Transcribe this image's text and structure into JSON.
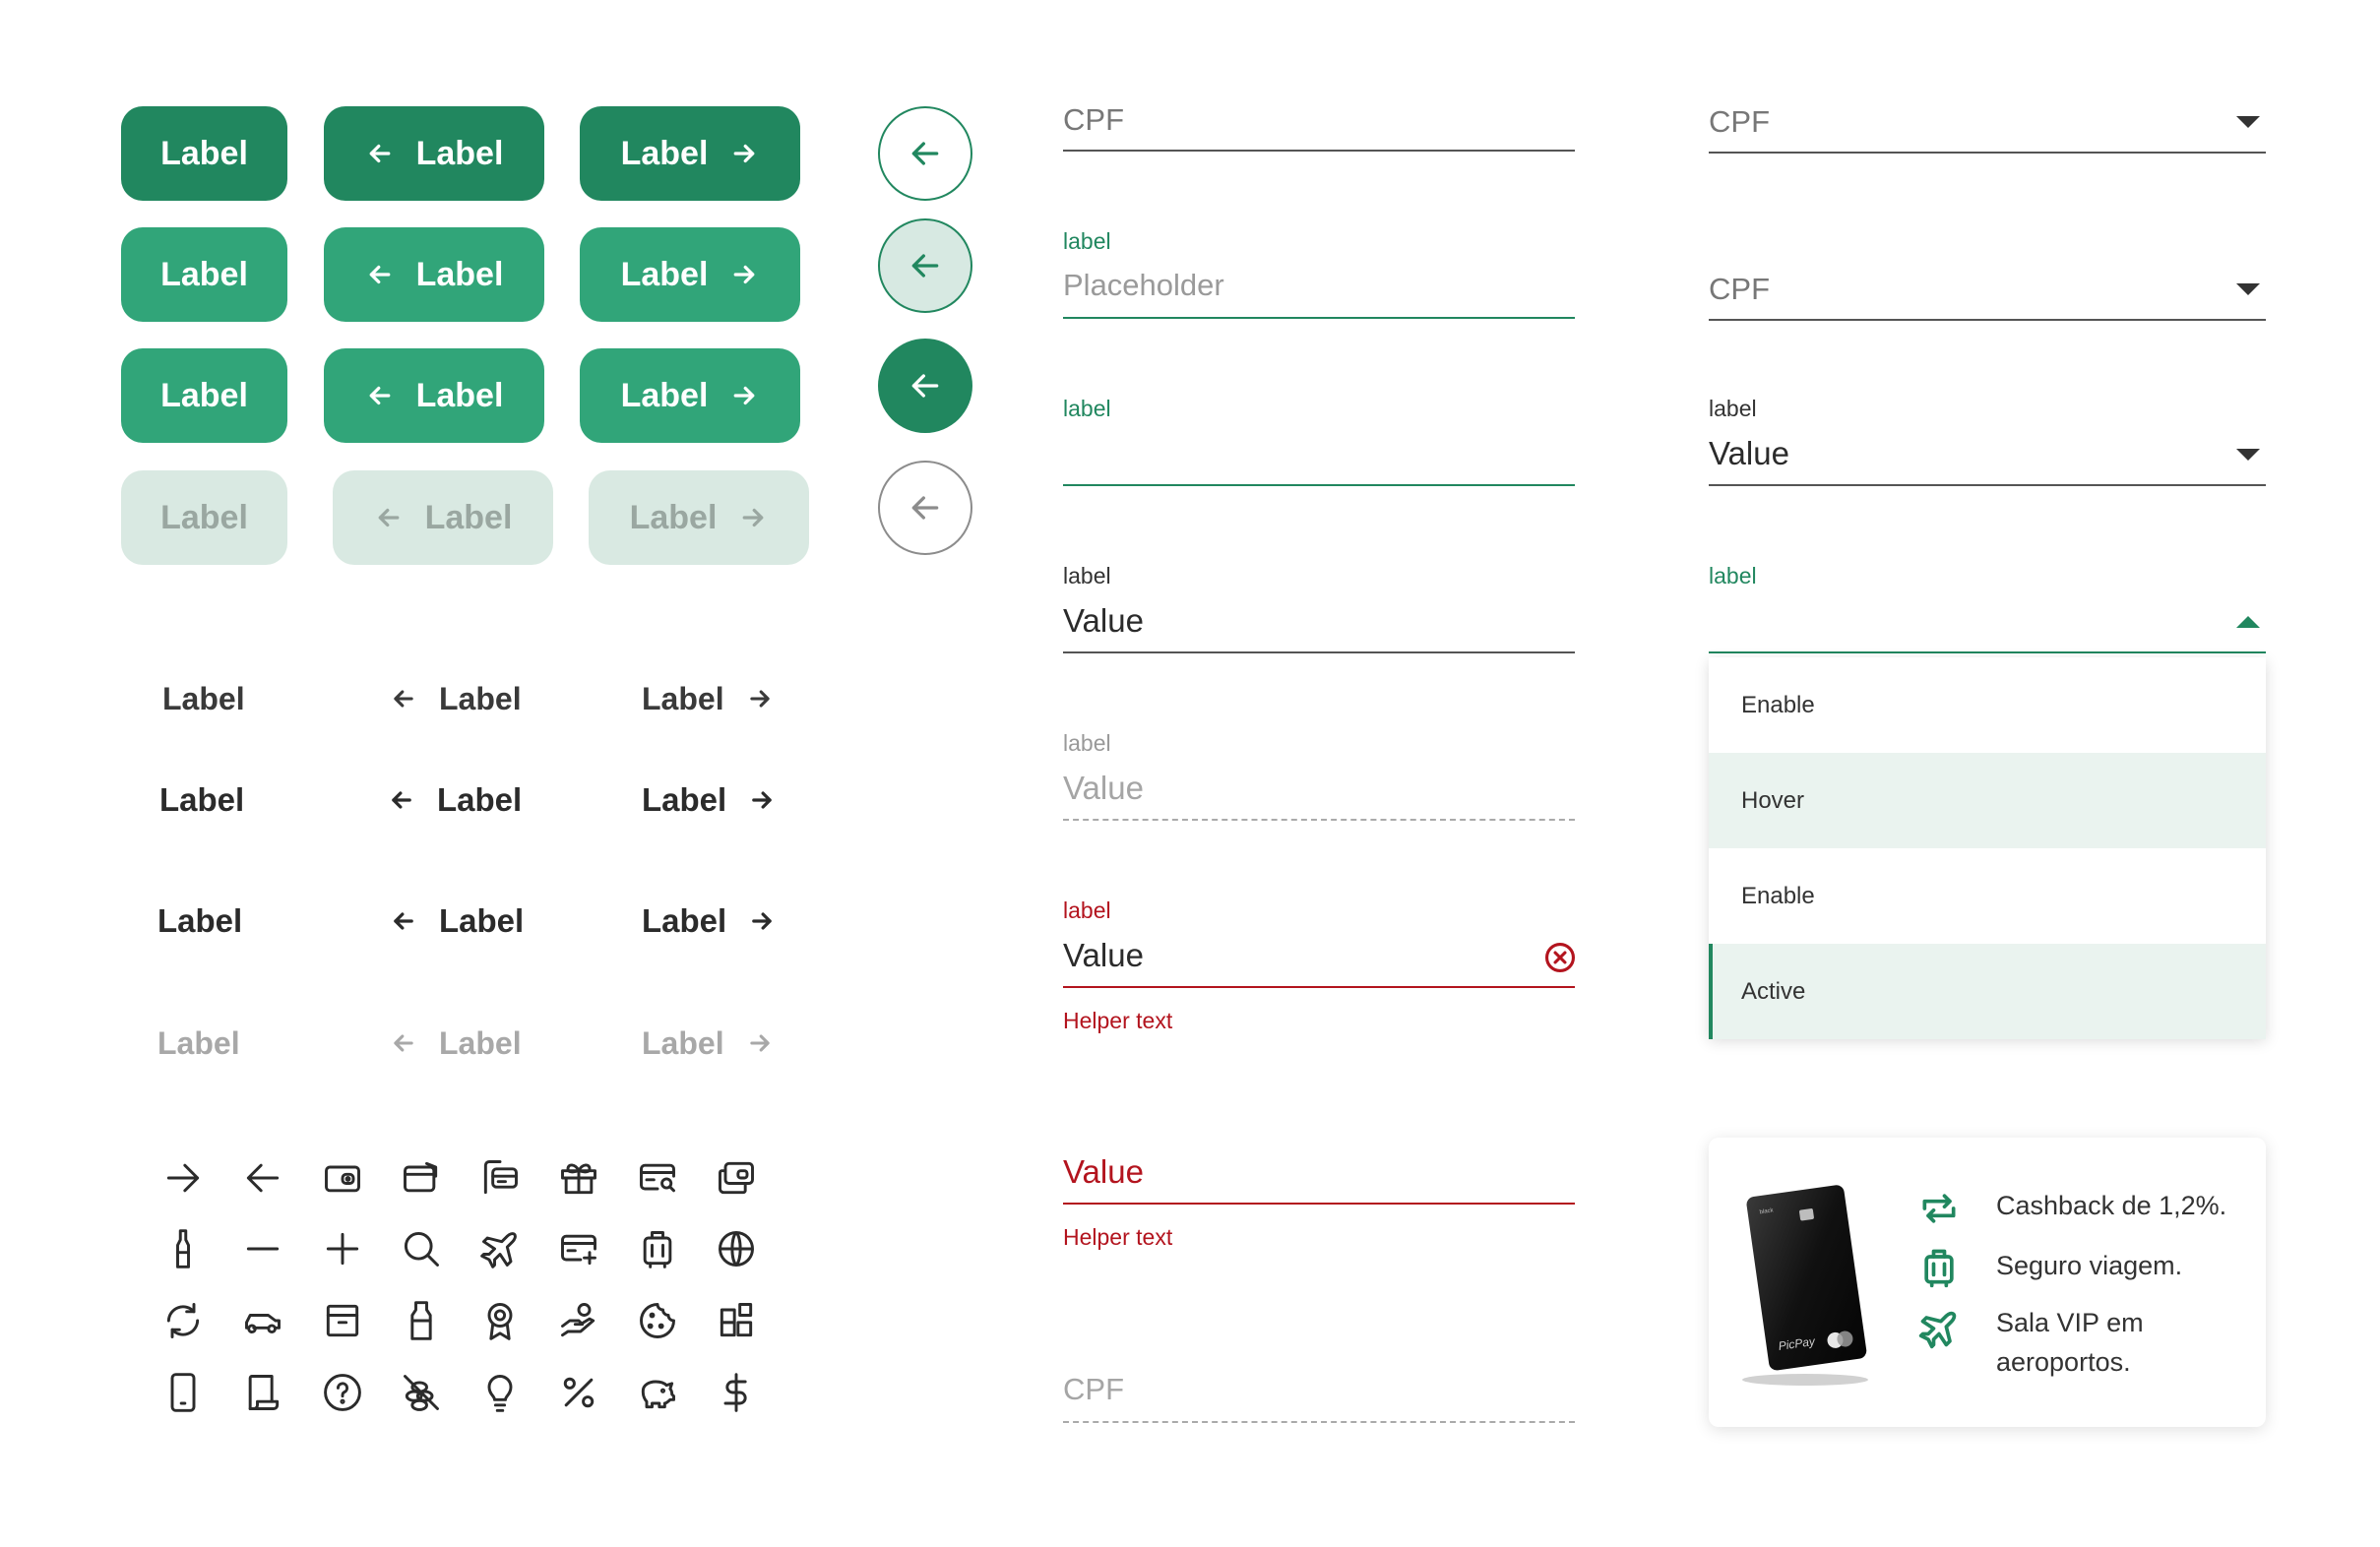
{
  "colors": {
    "primary_dark": "#21875f",
    "primary": "#31a579",
    "disabled_bg": "#d9e9e2",
    "error": "#b3141e",
    "text": "#2b2b2b"
  },
  "buttons": {
    "label": "Label",
    "rows": [
      "pressed",
      "hover",
      "default",
      "disabled"
    ]
  },
  "round_buttons": {
    "icon": "arrow-left-icon"
  },
  "text_buttons": {
    "label": "Label"
  },
  "icons": [
    "arrow-right-icon",
    "arrow-left-icon",
    "wallet-icon",
    "card-wallet-icon",
    "folder-card-icon",
    "gift-icon",
    "card-search-icon",
    "cards-icon",
    "bottle-icon",
    "minus-icon",
    "plus-icon",
    "search-icon",
    "airplane-icon",
    "card-add-icon",
    "luggage-icon",
    "globe-icon",
    "refresh-icon",
    "car-icon",
    "box-icon",
    "milk-icon",
    "award-icon",
    "hand-coins-icon",
    "cookie-icon",
    "widgets-icon",
    "phone-icon",
    "receipt-icon",
    "help-icon",
    "no-gluten-icon",
    "lightbulb-icon",
    "percent-icon",
    "piggy-bank-icon",
    "dollar-icon"
  ],
  "text_fields": [
    {
      "state": "default",
      "label": "",
      "value": "CPF"
    },
    {
      "state": "focused-placeholder",
      "label": "label",
      "value": "Placeholder"
    },
    {
      "state": "focused-empty",
      "label": "label",
      "value": ""
    },
    {
      "state": "filled",
      "label": "label",
      "value": "Value"
    },
    {
      "state": "disabled",
      "label": "label",
      "value": "Value"
    },
    {
      "state": "error",
      "label": "label",
      "value": "Value",
      "helper": "Helper text"
    },
    {
      "state": "error-no-label",
      "value": "Value",
      "helper": "Helper text"
    },
    {
      "state": "disabled-empty",
      "value": "CPF"
    }
  ],
  "selects": [
    {
      "state": "default",
      "value": "CPF"
    },
    {
      "state": "default-2",
      "value": "CPF"
    },
    {
      "state": "filled",
      "label": "label",
      "value": "Value"
    },
    {
      "state": "open",
      "label": "label",
      "value": ""
    }
  ],
  "dropdown": {
    "items": [
      {
        "label": "Enable",
        "state": "enable"
      },
      {
        "label": "Hover",
        "state": "hover"
      },
      {
        "label": "Enable",
        "state": "enable"
      },
      {
        "label": "Active",
        "state": "active"
      }
    ]
  },
  "card": {
    "card_brand": "PicPay",
    "card_tier": "black",
    "benefits": [
      {
        "icon": "repeat-icon",
        "text": "Cashback de 1,2%."
      },
      {
        "icon": "luggage-icon",
        "text": "Seguro viagem."
      },
      {
        "icon": "airplane-icon",
        "text": "Sala VIP em aeroportos."
      }
    ]
  }
}
